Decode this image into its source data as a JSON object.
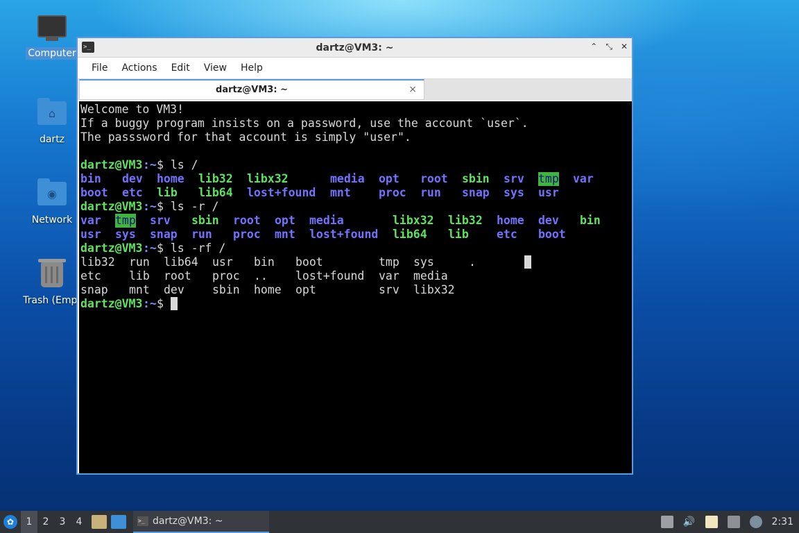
{
  "desktop": {
    "icons": [
      {
        "label": "Computer",
        "selected": true
      },
      {
        "label": "dartz"
      },
      {
        "label": "Network"
      },
      {
        "label": "Trash (Empty)",
        "label_visible": "Trash (Empt"
      }
    ]
  },
  "window": {
    "title": "dartz@VM3: ~",
    "menu": [
      "File",
      "Actions",
      "Edit",
      "View",
      "Help"
    ],
    "tab_label": "dartz@VM3: ~",
    "tab_close": "×",
    "controls": [
      "⌃",
      "⤡",
      "✕"
    ]
  },
  "terminal": {
    "motd": [
      "Welcome to VM3!",
      "If a buggy program insists on a password, use the account `user`.",
      "The passsword for that account is simply \"user\"."
    ],
    "prompt_user": "dartz@VM3",
    "prompt_path": ":~",
    "prompt_sign": "$ ",
    "cmd1": "ls /",
    "ls1": [
      [
        [
          "bin",
          "d"
        ],
        [
          "dev",
          "d"
        ],
        [
          "home",
          "d"
        ],
        [
          "lib32",
          "p"
        ],
        [
          "libx32",
          "p"
        ],
        [
          "media",
          "d"
        ],
        [
          "opt",
          "d"
        ],
        [
          "root",
          "d"
        ],
        [
          "sbin",
          "p"
        ],
        [
          "srv",
          "d"
        ],
        [
          "tmp",
          "hl"
        ],
        [
          "var",
          "d"
        ]
      ],
      [
        [
          "boot",
          "d"
        ],
        [
          "etc",
          "d"
        ],
        [
          "lib",
          "p"
        ],
        [
          "lib64",
          "p"
        ],
        [
          "lost+found",
          "d"
        ],
        [
          "mnt",
          "d"
        ],
        [
          "proc",
          "d"
        ],
        [
          "run",
          "d"
        ],
        [
          "snap",
          "d"
        ],
        [
          "sys",
          "d"
        ],
        [
          "usr",
          "d"
        ]
      ]
    ],
    "cmd2": "ls -r /",
    "ls2": [
      [
        [
          "var",
          "d"
        ],
        [
          "tmp",
          "hl"
        ],
        [
          "srv",
          "d"
        ],
        [
          "sbin",
          "p"
        ],
        [
          "root",
          "d"
        ],
        [
          "opt",
          "d"
        ],
        [
          "media",
          "d"
        ],
        [
          "libx32",
          "p"
        ],
        [
          "lib32",
          "p"
        ],
        [
          "home",
          "d"
        ],
        [
          "dev",
          "d"
        ],
        [
          "bin",
          "p"
        ]
      ],
      [
        [
          "usr",
          "d"
        ],
        [
          "sys",
          "d"
        ],
        [
          "snap",
          "d"
        ],
        [
          "run",
          "d"
        ],
        [
          "proc",
          "d"
        ],
        [
          "mnt",
          "d"
        ],
        [
          "lost+found",
          "d"
        ],
        [
          "lib64",
          "p"
        ],
        [
          "lib",
          "p"
        ],
        [
          "etc",
          "d"
        ],
        [
          "boot",
          "d"
        ]
      ]
    ],
    "cmd3": "ls -rf /",
    "ls3": [
      [
        "lib32",
        "run",
        "lib64",
        "usr",
        "bin",
        "boot",
        "tmp",
        "sys",
        "."
      ],
      [
        "etc",
        "lib",
        "root",
        "proc",
        "..",
        "lost+found",
        "var",
        "media"
      ],
      [
        "snap",
        "mnt",
        "dev",
        "sbin",
        "home",
        "opt",
        "srv",
        "libx32"
      ]
    ]
  },
  "taskbar": {
    "workspaces": [
      "1",
      "2",
      "3",
      "4"
    ],
    "active_workspace": "1",
    "task_label": "dartz@VM3: ~",
    "clock": "2:31"
  }
}
